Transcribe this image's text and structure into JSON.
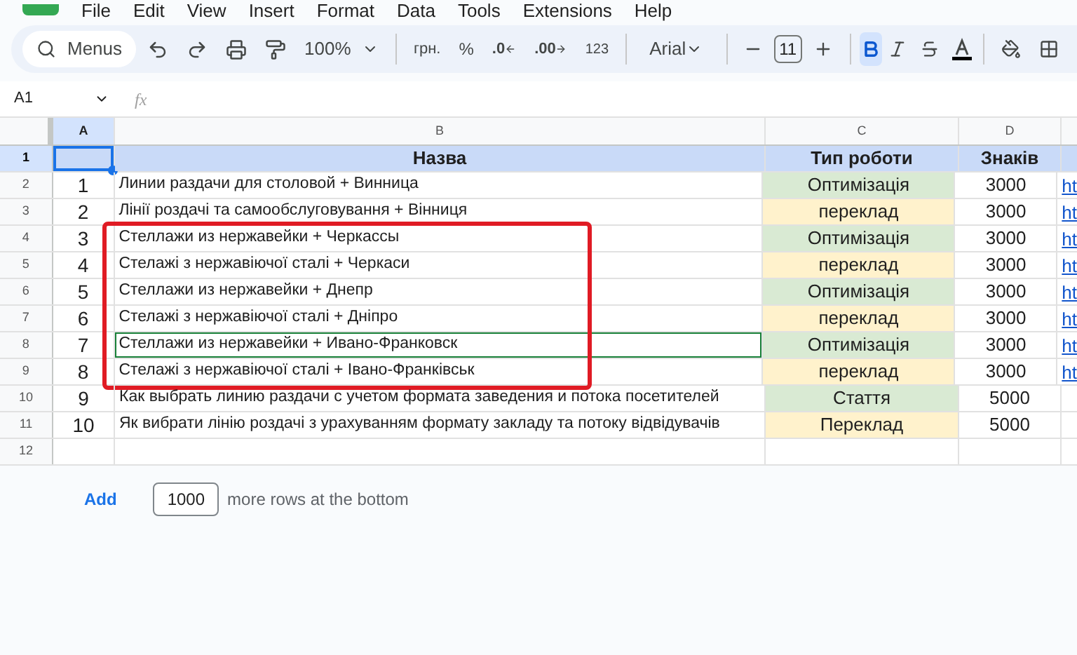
{
  "menu": [
    "File",
    "Edit",
    "View",
    "Insert",
    "Format",
    "Data",
    "Tools",
    "Extensions",
    "Help"
  ],
  "toolbar": {
    "search_label": "Menus",
    "zoom": "100%",
    "currency": "грн.",
    "percent": "%",
    "decrease_decimals": ".0",
    "increase_decimals": ".00",
    "number_format": "123",
    "font": "Arial",
    "font_size": "11",
    "bold": {
      "selected": true
    },
    "italic": {
      "selected": false
    }
  },
  "name_box": "A1",
  "formula_label": "fx",
  "columns": [
    {
      "label": "A",
      "selected": true
    },
    {
      "label": "B",
      "selected": false
    },
    {
      "label": "C",
      "selected": false
    },
    {
      "label": "D",
      "selected": false
    }
  ],
  "header_row": {
    "number": "1",
    "selected": true,
    "cells": [
      "",
      "Назва",
      "Тип роботи",
      "Знаків"
    ]
  },
  "row_groups": [
    {
      "highlighted": false,
      "rows": [
        {
          "number": "2",
          "index": "1",
          "name": "Линии раздачи для столовой + Винница",
          "type": {
            "text": "Оптимізація",
            "color": "#d9ead3"
          },
          "chars": "3000",
          "link": "ht",
          "outlined": false
        },
        {
          "number": "3",
          "index": "2",
          "name": "Лінії роздачі та самообслуговування + Вінниця",
          "type": {
            "text": "переклад",
            "color": "#fff2cc"
          },
          "chars": "3000",
          "link": "ht",
          "outlined": false
        }
      ]
    },
    {
      "highlighted": true,
      "rows": [
        {
          "number": "4",
          "index": "3",
          "name": "Стеллажи из нержавейки + Черкассы",
          "type": {
            "text": "Оптимізація",
            "color": "#d9ead3"
          },
          "chars": "3000",
          "link": "ht",
          "outlined": false
        },
        {
          "number": "5",
          "index": "4",
          "name": "Стелажі з нержавіючої сталі + Черкаси",
          "type": {
            "text": "переклад",
            "color": "#fff2cc"
          },
          "chars": "3000",
          "link": "ht",
          "outlined": false
        },
        {
          "number": "6",
          "index": "5",
          "name": "Стеллажи из нержавейки + Днепр",
          "type": {
            "text": "Оптимізація",
            "color": "#d9ead3"
          },
          "chars": "3000",
          "link": "ht",
          "outlined": false
        },
        {
          "number": "7",
          "index": "6",
          "name": "Стелажі з нержавіючої сталі + Дніпро",
          "type": {
            "text": "переклад",
            "color": "#fff2cc"
          },
          "chars": "3000",
          "link": "ht",
          "outlined": false
        },
        {
          "number": "8",
          "index": "7",
          "name": "Стеллажи из нержавейки + Ивано-Франковск",
          "type": {
            "text": "Оптимізація",
            "color": "#d9ead3"
          },
          "chars": "3000",
          "link": "ht",
          "outlined": true
        },
        {
          "number": "9",
          "index": "8",
          "name": "Стелажі з нержавіючої сталі + Івано-Франківськ",
          "type": {
            "text": "переклад",
            "color": "#fff2cc"
          },
          "chars": "3000",
          "link": "ht",
          "outlined": false
        }
      ]
    },
    {
      "highlighted": false,
      "rows": [
        {
          "number": "10",
          "index": "9",
          "name": "Как выбрать линию раздачи с учетом формата заведения и потока посетителей",
          "type": {
            "text": "Стаття",
            "color": "#d9ead3"
          },
          "chars": "5000",
          "outlined": false
        },
        {
          "number": "11",
          "index": "10",
          "name": "Як вибрати лінію роздачі з урахуванням формату закладу та потоку відвідувачів",
          "type": {
            "text": "Переклад",
            "color": "#fff2cc"
          },
          "chars": "5000",
          "outlined": false
        },
        {
          "number": "12"
        }
      ]
    }
  ],
  "footer": {
    "add_button": "Add",
    "rows_count": "1000",
    "rows_text": "more rows at the bottom"
  }
}
